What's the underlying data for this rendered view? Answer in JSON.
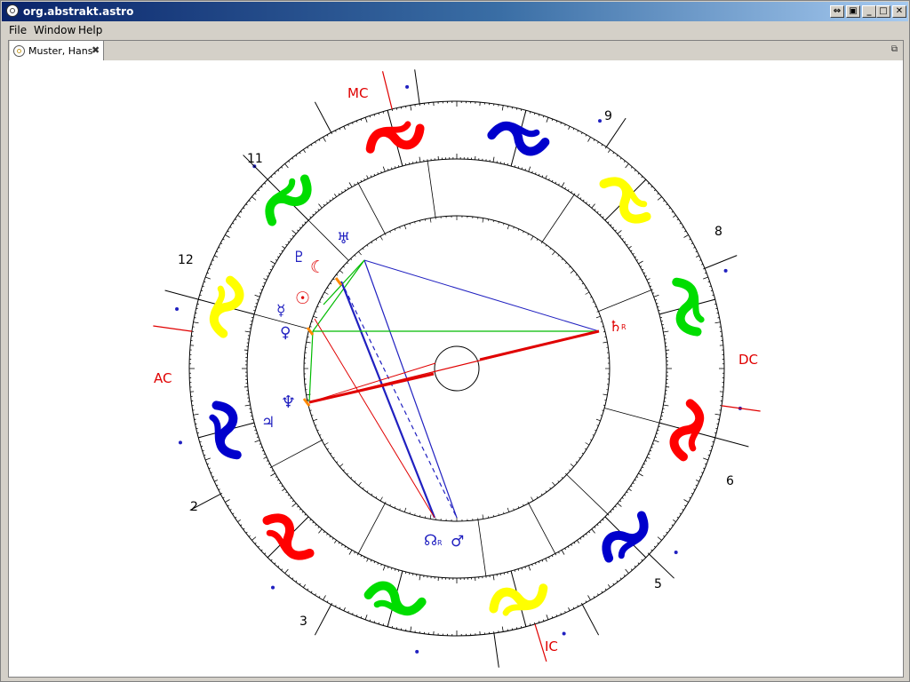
{
  "window": {
    "title": "org.abstrakt.astro"
  },
  "menu": {
    "file": "File",
    "window": "Window",
    "help": "Help"
  },
  "tab": {
    "label": "Muster, Hans"
  },
  "icons": {
    "app": "astro-app-icon",
    "tab": "horoscope-icon",
    "close": "close-icon",
    "restore": "restore-icon"
  },
  "chart": {
    "angles": {
      "mc": "MC",
      "ic": "IC",
      "ac": "AC",
      "dc": "DC"
    },
    "houses": [
      "2",
      "3",
      "5",
      "6",
      "8",
      "9",
      "11",
      "12"
    ],
    "planets": {
      "uranus": "♅",
      "moon": "☾",
      "sun": "☉",
      "mercury": "☿",
      "venus": "♀",
      "neptune": "♆",
      "jupiter": "♃",
      "pluto": "♇",
      "saturn": "♄",
      "node": "☊",
      "mars": "♂"
    },
    "retrograde_marker": "R",
    "colors": {
      "fire": "#ff0000",
      "earth": "#00dd00",
      "air": "#ffff00",
      "water": "#0000cc",
      "angles": "#e00000",
      "planets": "#2020c0"
    },
    "signs": [
      {
        "name": "Leo",
        "element": "fire"
      },
      {
        "name": "Cancer",
        "element": "water"
      },
      {
        "name": "Gemini",
        "element": "air"
      },
      {
        "name": "Taurus",
        "element": "earth"
      },
      {
        "name": "Aries",
        "element": "fire"
      },
      {
        "name": "Pisces",
        "element": "water"
      },
      {
        "name": "Aquarius",
        "element": "air"
      },
      {
        "name": "Capricorn",
        "element": "earth"
      },
      {
        "name": "Sagittarius",
        "element": "fire"
      },
      {
        "name": "Scorpio",
        "element": "water"
      },
      {
        "name": "Libra",
        "element": "air"
      },
      {
        "name": "Virgo",
        "element": "earth"
      }
    ]
  }
}
